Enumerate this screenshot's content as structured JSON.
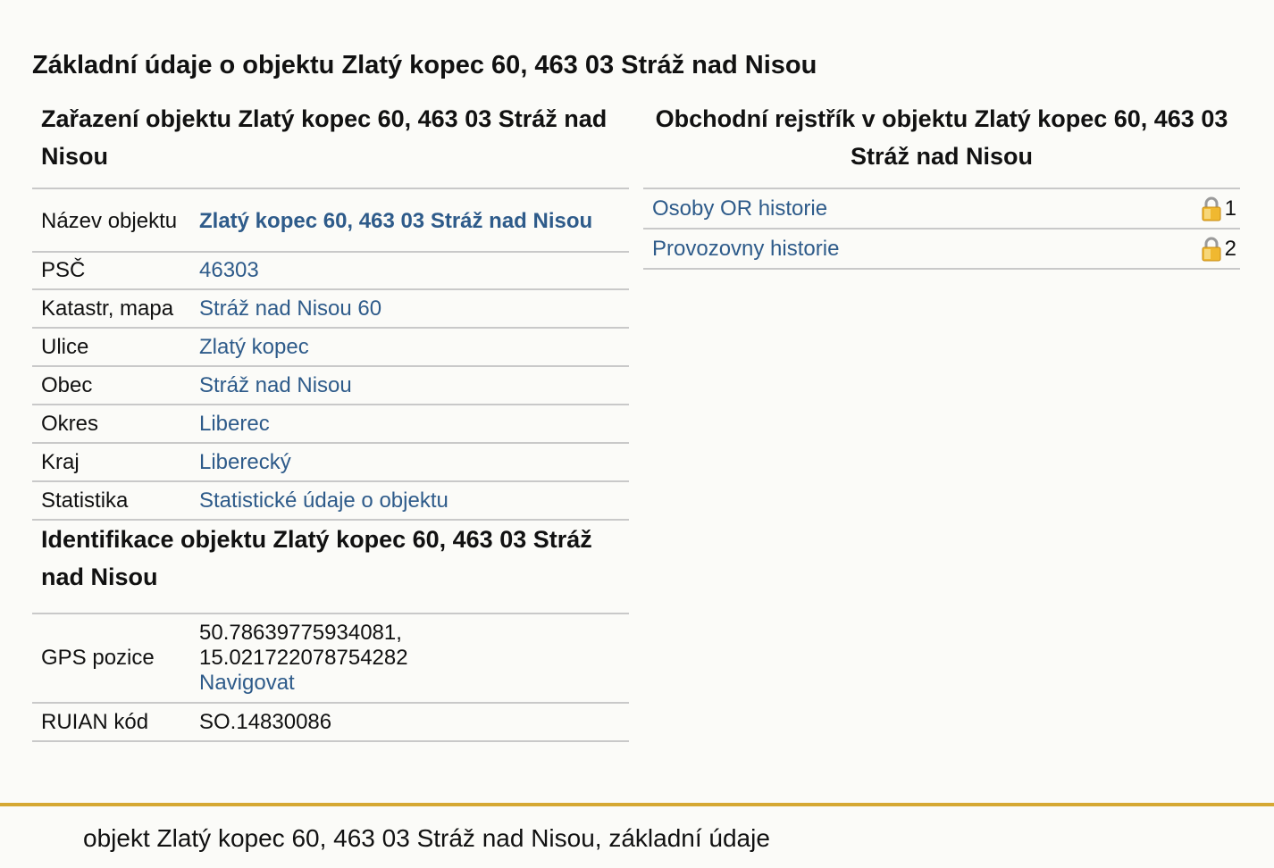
{
  "page_title": "Základní údaje o objektu Zlatý kopec 60, 463 03 Stráž nad Nisou",
  "classification": {
    "title": "Zařazení objektu Zlatý kopec 60, 463 03 Stráž nad Nisou",
    "rows": {
      "name": {
        "label": "Název objektu",
        "value": "Zlatý kopec 60, 463 03 Stráž nad Nisou"
      },
      "psc": {
        "label": "PSČ",
        "value": "46303"
      },
      "cadastre": {
        "label": "Katastr, mapa",
        "value": "Stráž nad Nisou 60"
      },
      "street": {
        "label": "Ulice",
        "value": "Zlatý kopec"
      },
      "municipality": {
        "label": "Obec",
        "value": "Stráž nad Nisou"
      },
      "district": {
        "label": "Okres",
        "value": "Liberec"
      },
      "region": {
        "label": "Kraj",
        "value": "Liberecký"
      },
      "statistics": {
        "label": "Statistika",
        "value": "Statistické údaje o objektu"
      }
    }
  },
  "identification": {
    "title": "Identifikace objektu Zlatý kopec 60, 463 03 Stráž nad Nisou",
    "gps": {
      "label": "GPS pozice",
      "lat": "50.78639775934081,",
      "lon": "15.021722078754282",
      "navigate": "Navigovat"
    },
    "ruian": {
      "label": "RUIAN kód",
      "value": "SO.14830086"
    }
  },
  "business_register": {
    "title": "Obchodní rejstřík v objektu Zlatý kopec 60, 463 03 Stráž nad Nisou",
    "items": [
      {
        "label": "Osoby OR historie",
        "count": "1",
        "icon": "lock-icon"
      },
      {
        "label": "Provozovny historie",
        "count": "2",
        "icon": "lock-icon"
      }
    ]
  },
  "footer": {
    "text": "objekt Zlatý kopec 60, 463 03 Stráž nad Nisou, základní údaje"
  },
  "colors": {
    "link": "#2e5b8a",
    "background": "#fbfbf8",
    "divider": "#c9c9c9",
    "footer_rule": "#d5a833",
    "lock_body": "#f0b830"
  }
}
